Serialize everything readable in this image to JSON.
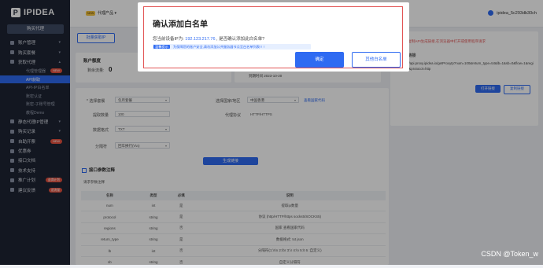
{
  "sidebar": {
    "logo": "IPIDEA",
    "buy_button": "购买代理",
    "items": [
      {
        "label": "账户管理",
        "chevron": "▾"
      },
      {
        "label": "购买套餐",
        "chevron": "▾"
      },
      {
        "label": "获取代理",
        "chevron": "▴"
      }
    ],
    "sub_items": [
      {
        "label": "代理管理器",
        "badge": "NEW"
      },
      {
        "label": "API获取",
        "active": true
      },
      {
        "label": "API-IP白名单"
      },
      {
        "label": "账密认证"
      },
      {
        "label": "账密-子账号管理"
      },
      {
        "label": "教程Demo"
      }
    ],
    "items2": [
      {
        "label": "静态代理IP管理",
        "chevron": "▾"
      },
      {
        "label": "购买记录",
        "chevron": "▾"
      },
      {
        "label": "自助开票",
        "badge": "NEW"
      },
      {
        "label": "优惠券"
      },
      {
        "label": "接口文档"
      },
      {
        "label": "技术支持"
      },
      {
        "label": "推广计划",
        "badge": "返佣计划"
      },
      {
        "label": "建议反馈",
        "badge": "送流量"
      }
    ]
  },
  "topbar": {
    "tag_new": "NEW",
    "tag_label": "代理产品 ▾",
    "username": "ipidea_5c293db30ch"
  },
  "main": {
    "extract_button": "批量获取IP",
    "account_card_title": "账户额度",
    "remaining_label": "剩余流量:",
    "remaining_value": "0",
    "expire_text": "到期时间 2023-10-20",
    "right_hint": "请复制API生成链接,在浏览器中打开或使用程序请求",
    "right_link_label": "API链接",
    "api_link": "http://api.proxy.ipidea.io/getProxyIp?num=100&return_type=txt&lb=1&sb=0&flow=1&regions=&protocol=http",
    "open_link_button": "打开链接",
    "copy_link_button": "复制链接",
    "form": {
      "mode_label": "* 选择套餐",
      "mode_value": "包月套餐",
      "country_label": "选择国家/地区",
      "country_value": "中国香港",
      "country_link": "查看国家代码",
      "count_label": "提取数量",
      "count_value": "100",
      "protocol_label": "代理协议",
      "protocol_value": "HTTP/HTTPS",
      "format_label": "数据格式",
      "format_value": "TXT",
      "separator_label": "分隔符",
      "separator_value": "回车换行(\\r\\n)",
      "generate_button": "生成链接"
    },
    "params_title": "接口参数注释",
    "params_subtitle": "请求参数注释",
    "table_headers": [
      "名称",
      "类型",
      "必填",
      "说明"
    ],
    "table_rows": [
      [
        "num",
        "int",
        "是",
        "提取ip数量"
      ],
      [
        "protocol",
        "string",
        "是",
        "协议 (http/HTTP/https socks5/SOCKS5)"
      ],
      [
        "regions",
        "string",
        "否",
        "国家 查看国家代码"
      ],
      [
        "return_type",
        "string",
        "是",
        "数据格式: txt json"
      ],
      [
        "lb",
        "int",
        "否",
        "分隔符(1:\\r\\n 2:/br 3:\\r 4:\\n 5:\\t 6 :自定义)"
      ],
      [
        "sb",
        "string",
        "否",
        "自定义分隔符"
      ]
    ]
  },
  "modal": {
    "title": "确认添加白名单",
    "prompt_prefix": "您当前设备IP为:",
    "ip": "192.123.217.76",
    "prompt_suffix": ", 是否确认添加此白名单?",
    "note_tag": "温馨提示",
    "note_text": "为保障您的账户安全,请勿添加公共服务器节点至白名单列表! ! !",
    "confirm_button": "确定",
    "whitelist_button": "其他白名单"
  },
  "watermark": "CSDN @Token_w",
  "colors": {
    "accent": "#2f6bf2",
    "sidebar_bg": "#1e2433",
    "highlight_border": "#e25555"
  }
}
